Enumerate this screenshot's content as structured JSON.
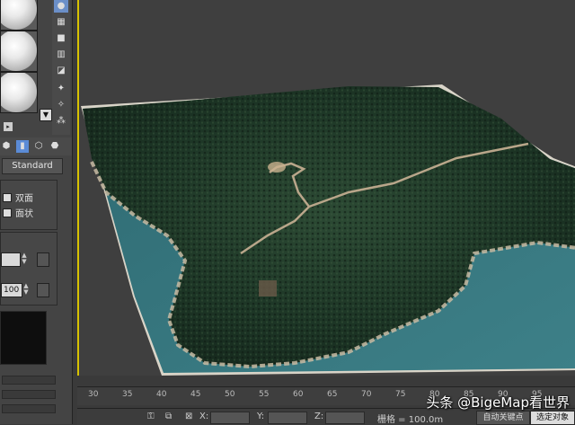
{
  "material_editor": {
    "standard_label": "Standard",
    "double_sided_label": "双面",
    "faceted_label": "面状",
    "spinner_value": "100"
  },
  "timeline": {
    "ticks": [
      "30",
      "35",
      "40",
      "45",
      "50",
      "55",
      "60",
      "65",
      "70",
      "75",
      "80",
      "85",
      "90",
      "95"
    ]
  },
  "statusbar": {
    "x_label": "X:",
    "y_label": "Y:",
    "z_label": "Z:",
    "grid_label": "栅格 = 100.0m",
    "auto_key_label": "自动关键点",
    "selected_label": "选定对象"
  },
  "watermark": {
    "text": "头条 @BigeMap看世界"
  },
  "colors": {
    "viewport_border": "#d7c200",
    "panel_bg": "#444444",
    "viewport_bg": "#3f3f3f"
  }
}
